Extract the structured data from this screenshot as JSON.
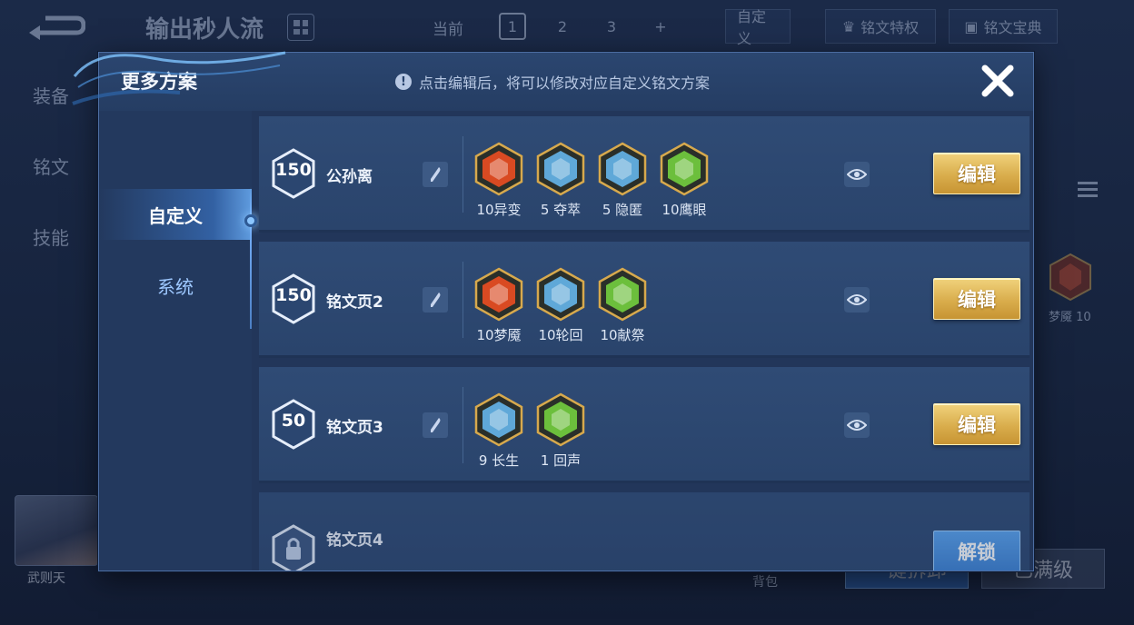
{
  "background": {
    "scheme_title": "输出秒人流",
    "current_label": "当前",
    "page_tabs": [
      "1",
      "2",
      "3",
      "+"
    ],
    "active_page": "1",
    "custom_button": "自定义",
    "privilege_button": "铭文特权",
    "manual_button": "铭文宝典",
    "side_tabs": [
      "装备",
      "铭文",
      "技能"
    ],
    "right_rune_label": "梦魇 10",
    "hero_name": "武则天",
    "bottom_label": "背包",
    "bottom_buttons": [
      "一键拆卸",
      "已满级"
    ]
  },
  "modal": {
    "title": "更多方案",
    "hint": "点击编辑后，将可以修改对应自定义铭文方案",
    "close_label": "✕"
  },
  "sidebar": {
    "items": [
      {
        "label": "自定义",
        "active": true
      },
      {
        "label": "系统",
        "active": false
      }
    ]
  },
  "plans": [
    {
      "level": "150",
      "name": "公孙离",
      "action": "编辑",
      "locked": false,
      "runes": [
        {
          "label": "10异变",
          "color": "#d94a22",
          "icon": "red-rune-icon"
        },
        {
          "label": "5 夺萃",
          "color": "#5fa8d8",
          "icon": "blue-rune-icon"
        },
        {
          "label": "5 隐匿",
          "color": "#5fa8d8",
          "icon": "blue-rune-icon"
        },
        {
          "label": "10鹰眼",
          "color": "#6cbf3c",
          "icon": "green-rune-icon"
        }
      ]
    },
    {
      "level": "150",
      "name": "铭文页2",
      "action": "编辑",
      "locked": false,
      "runes": [
        {
          "label": "10梦魇",
          "color": "#d94a22",
          "icon": "red-rune-icon"
        },
        {
          "label": "10轮回",
          "color": "#5fa8d8",
          "icon": "blue-rune-icon"
        },
        {
          "label": "10献祭",
          "color": "#6cbf3c",
          "icon": "green-rune-icon"
        }
      ]
    },
    {
      "level": "50",
      "name": "铭文页3",
      "action": "编辑",
      "locked": false,
      "runes": [
        {
          "label": "9 长生",
          "color": "#5fa8d8",
          "icon": "blue-rune-icon"
        },
        {
          "label": "1 回声",
          "color": "#6cbf3c",
          "icon": "green-rune-icon"
        }
      ]
    },
    {
      "level": "",
      "name": "铭文页4",
      "action": "解锁",
      "locked": true,
      "runes": []
    }
  ],
  "colors": {
    "edit_button": "#d9ad4c",
    "unlock_button": "#3d82d4",
    "row_bg": "#2f4b75",
    "accent": "#8cc6ff"
  }
}
